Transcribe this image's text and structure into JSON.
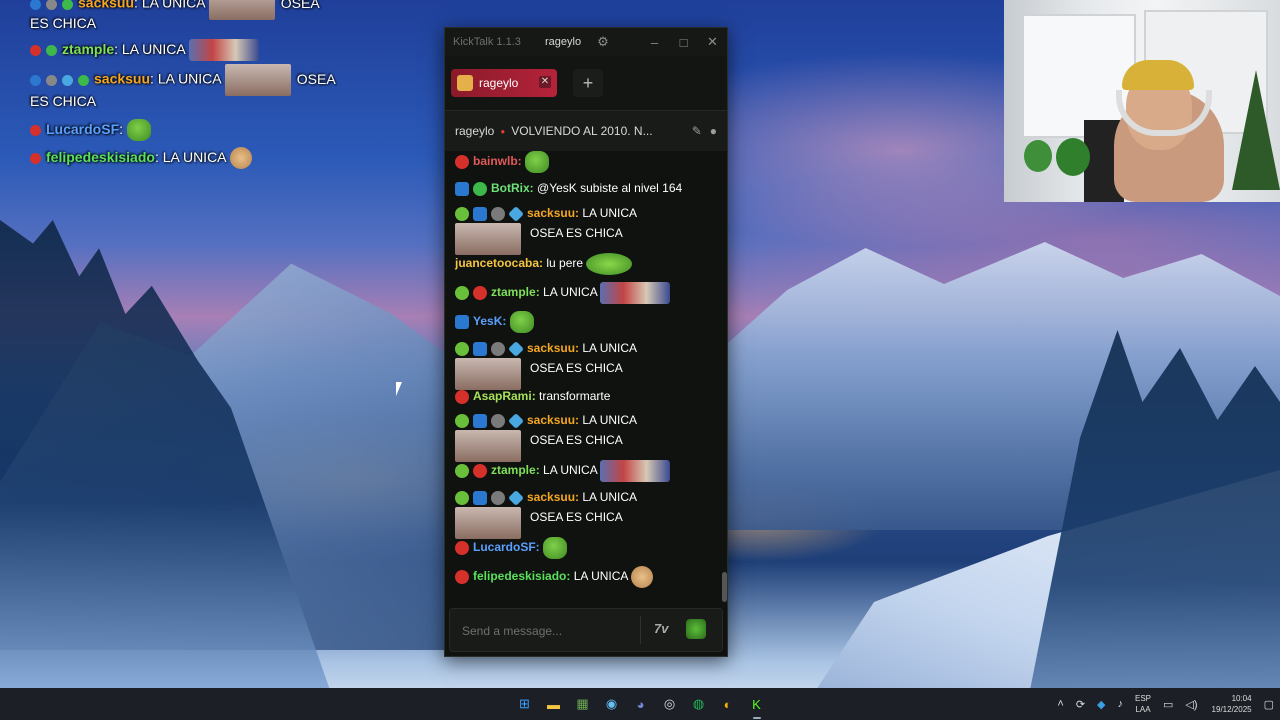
{
  "desktop": {
    "overlay_chat": [
      {
        "user": "sacksuu",
        "user_color": "#f5a623",
        "text": "LA UNICA",
        "badges": [
          "blue",
          "grey",
          "green"
        ],
        "emote": "avatar",
        "after": "OSEA",
        "partial_top": true
      },
      {
        "continuation": "ES CHICA"
      },
      {
        "user": "ztample",
        "user_color": "#7fe05a",
        "text": "LA UNICA",
        "badges": [
          "red",
          "green"
        ],
        "emote": "wide"
      },
      {
        "user": "sacksuu",
        "user_color": "#f5a623",
        "text": "LA UNICA",
        "badges": [
          "blue",
          "grey",
          "cube",
          "green"
        ],
        "emote": "avatar",
        "after": "OSEA"
      },
      {
        "continuation": "ES CHICA"
      },
      {
        "user": "LucardoSF",
        "user_color": "#5aa0ff",
        "text": "",
        "badges": [
          "red"
        ],
        "emote": "frog"
      },
      {
        "user": "felipedeskisiado",
        "user_color": "#5ae05a",
        "text": "LA UNICA",
        "badges": [
          "red"
        ],
        "emote": "dog"
      }
    ]
  },
  "kicktalk": {
    "app_title": "KickTalk 1.1.3",
    "user": "rageylo",
    "gear": "⚙",
    "minimize": "–",
    "maximize": "□",
    "close": "✕",
    "tab": {
      "label": "rageylo",
      "close": "✕"
    },
    "add_tab": "+",
    "stream": {
      "name": "rageylo",
      "live_dot": "●",
      "title": "VOLVIENDO AL 2010. N..."
    },
    "messages": [
      {
        "user": "bainwlb",
        "color": "#e05a5a",
        "sep": ":",
        "text": ""
      },
      {
        "user": "BotRix",
        "color": "#6fe07a",
        "sep": ":",
        "text": "@YesK subiste al nivel 164"
      },
      {
        "user": "sacksuu",
        "color": "#f5a623",
        "sep": ":",
        "text": "LA UNICA",
        "cont": "OSEA ES CHICA"
      },
      {
        "user": "juancetoocaba",
        "color": "#f5c542",
        "sep": ":",
        "text": "lu pere"
      },
      {
        "user": "ztample",
        "color": "#7fe05a",
        "sep": ":",
        "text": "LA UNICA"
      },
      {
        "user": "YesK",
        "color": "#5aa0ff",
        "sep": ":",
        "text": ""
      },
      {
        "user": "sacksuu",
        "color": "#f5a623",
        "sep": ":",
        "text": "LA UNICA",
        "cont": "OSEA ES CHICA"
      },
      {
        "user": "AsapRami",
        "color": "#a8e05a",
        "sep": ":",
        "text": "transformarte"
      },
      {
        "user": "sacksuu",
        "color": "#f5a623",
        "sep": ":",
        "text": "LA UNICA",
        "cont": "OSEA ES CHICA"
      },
      {
        "user": "ztample",
        "color": "#7fe05a",
        "sep": ":",
        "text": "LA UNICA"
      },
      {
        "user": "sacksuu",
        "color": "#f5a623",
        "sep": ":",
        "text": "LA UNICA",
        "cont": "OSEA ES CHICA"
      },
      {
        "user": "LucardoSF",
        "color": "#5aa0ff",
        "sep": ":",
        "text": ""
      },
      {
        "user": "felipedeskisiado",
        "color": "#5ae05a",
        "sep": ":",
        "text": "LA UNICA"
      }
    ],
    "input": {
      "placeholder": "Send a message..."
    },
    "seventv": "7tv"
  },
  "taskbar": {
    "apps": [
      {
        "name": "windows-start-icon",
        "glyph": "⊞",
        "color": "#3aa0ff"
      },
      {
        "name": "file-explorer-icon",
        "glyph": "▬",
        "color": "#f2c744"
      },
      {
        "name": "minecraft-icon",
        "glyph": "▦",
        "color": "#6aa84f"
      },
      {
        "name": "steam-icon",
        "glyph": "◉",
        "color": "#66c0f4"
      },
      {
        "name": "discord-icon",
        "glyph": "◕",
        "color": "#7289da"
      },
      {
        "name": "obs-icon",
        "glyph": "◎",
        "color": "#dddddd"
      },
      {
        "name": "spotify-icon",
        "glyph": "◍",
        "color": "#1db954"
      },
      {
        "name": "chrome-icon",
        "glyph": "◐",
        "color": "#f4b400"
      },
      {
        "name": "kick-icon",
        "glyph": "K",
        "color": "#53fc18"
      }
    ],
    "tray": {
      "lang_top": "ESP",
      "lang_bottom": "LAA",
      "time": "10:04",
      "date": "19/12/2025"
    }
  }
}
